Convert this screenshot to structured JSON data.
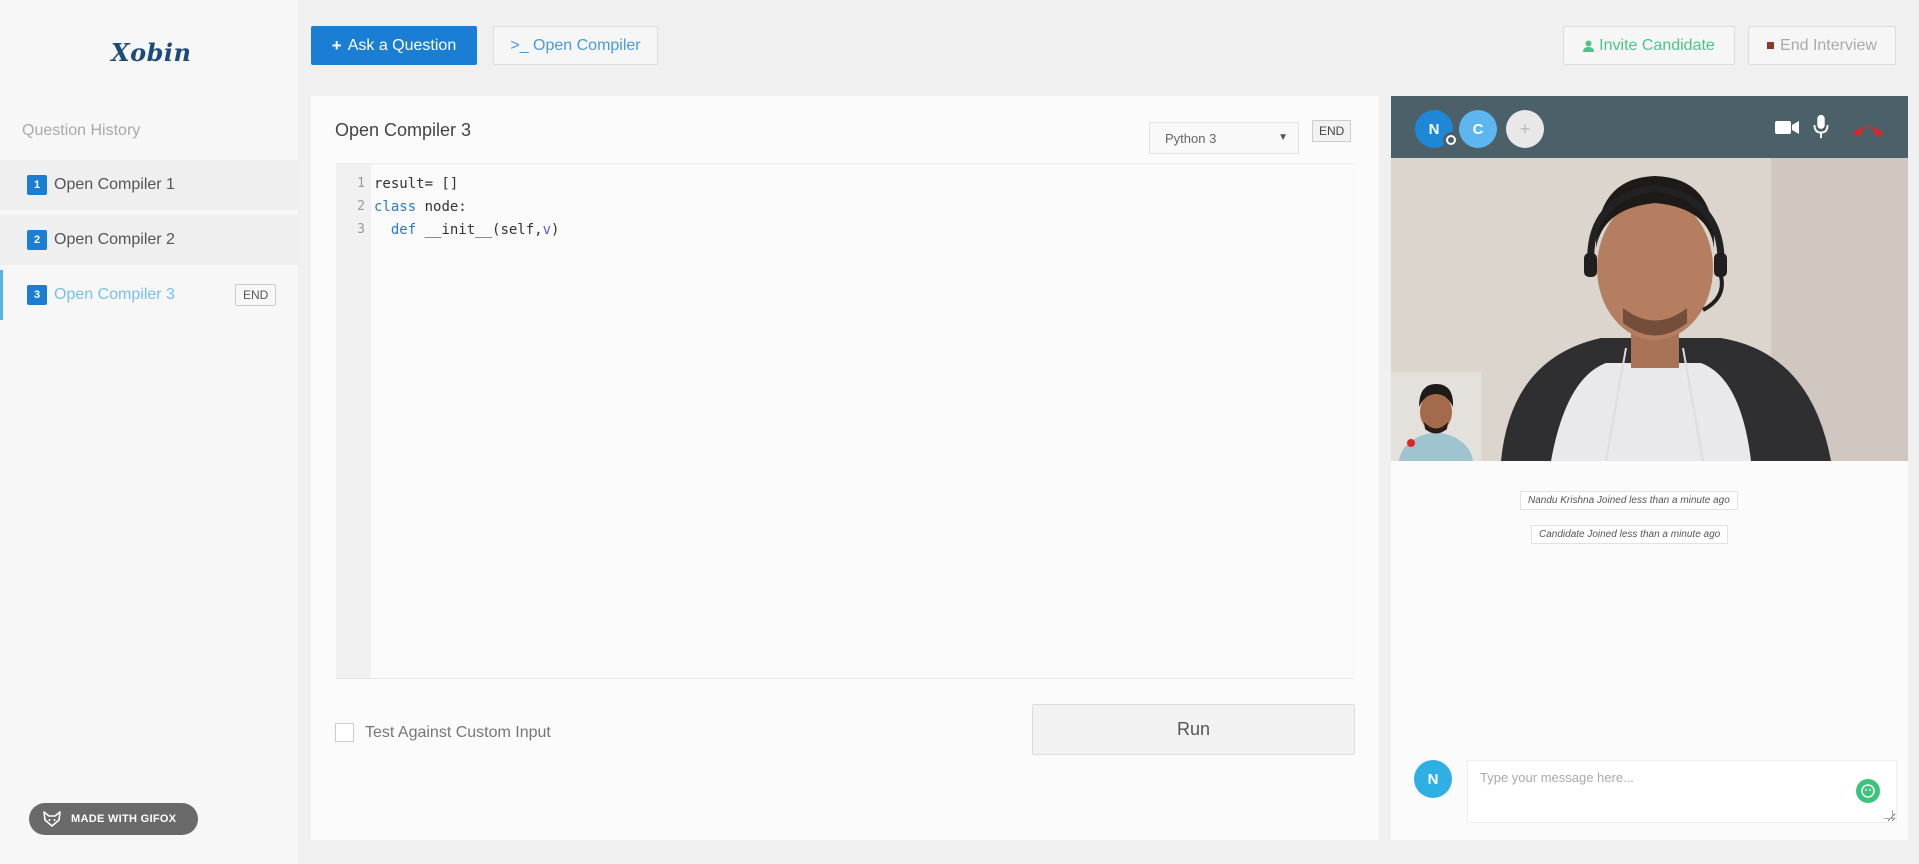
{
  "app": {
    "logo": "Xobin"
  },
  "sidebar": {
    "title": "Question History",
    "items": [
      {
        "num": "1",
        "label": "Open Compiler 1"
      },
      {
        "num": "2",
        "label": "Open Compiler 2"
      },
      {
        "num": "3",
        "label": "Open Compiler 3",
        "end_label": "END"
      }
    ]
  },
  "toolbar": {
    "ask_label": "Ask a Question",
    "compiler_label": ">_ Open Compiler",
    "invite_label": "Invite Candidate",
    "end_interview_label": "End Interview"
  },
  "editor": {
    "title": "Open Compiler 3",
    "language": "Python 3",
    "end_label": "END",
    "lines": [
      {
        "n": "1",
        "code": "result= []"
      },
      {
        "n": "2",
        "code": "class node:"
      },
      {
        "n": "3",
        "code": "  def __init__(self,v)"
      }
    ],
    "custom_input_label": "Test Against Custom Input",
    "run_label": "Run"
  },
  "call": {
    "participants": [
      {
        "initial": "N",
        "color": "#1e88d6"
      },
      {
        "initial": "C",
        "color": "#5db6f0"
      }
    ],
    "add_label": "+",
    "messages": [
      "Nandu Krishna Joined less than a minute ago",
      "Candidate Joined less than a minute ago"
    ],
    "chat_avatar": "N",
    "chat_placeholder": "Type your message here..."
  },
  "watermark": "MADE WITH GIFOX",
  "colors": {
    "primary": "#1a7fd4",
    "invite": "#4cc58b",
    "callbar": "#4b6068",
    "hangup": "#e0242a"
  }
}
